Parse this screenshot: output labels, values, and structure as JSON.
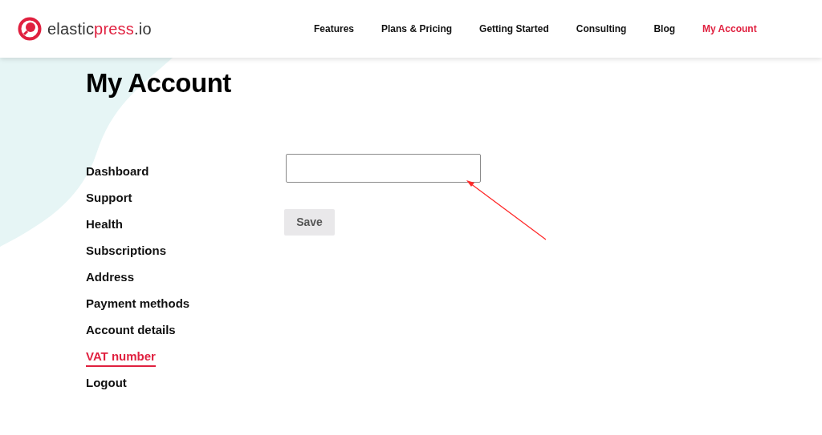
{
  "logo": {
    "parts": [
      {
        "text": "elastic",
        "highlight": false
      },
      {
        "text": "press",
        "highlight": true
      },
      {
        "text": ".io",
        "highlight": false
      }
    ]
  },
  "nav": [
    {
      "label": "Features",
      "selected": false
    },
    {
      "label": "Plans & Pricing",
      "selected": false
    },
    {
      "label": "Getting Started",
      "selected": false
    },
    {
      "label": "Consulting",
      "selected": false
    },
    {
      "label": "Blog",
      "selected": false
    },
    {
      "label": "My Account",
      "selected": true
    }
  ],
  "page_title": "My Account",
  "sidebar": {
    "items": [
      {
        "label": "Dashboard",
        "selected": false
      },
      {
        "label": "Support",
        "selected": false
      },
      {
        "label": "Health",
        "selected": false
      },
      {
        "label": "Subscriptions",
        "selected": false
      },
      {
        "label": "Address",
        "selected": false
      },
      {
        "label": "Payment methods",
        "selected": false
      },
      {
        "label": "Account details",
        "selected": false
      },
      {
        "label": "VAT number",
        "selected": true
      },
      {
        "label": "Logout",
        "selected": false
      }
    ]
  },
  "form": {
    "save_button": "Save"
  }
}
